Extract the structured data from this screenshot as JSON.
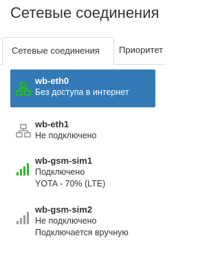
{
  "page": {
    "title": "Сетевые соединения"
  },
  "tabs": [
    {
      "label": "Сетевые соединения",
      "active": true
    },
    {
      "label": "Приоритет",
      "active": false
    }
  ],
  "connections": [
    {
      "name": "wb-eth0",
      "lines": [
        "Без доступа в интернет"
      ],
      "icon": "ethernet-icon",
      "icon_color": "#22bb22",
      "selected": true
    },
    {
      "name": "wb-eth1",
      "lines": [
        "Не подключено"
      ],
      "icon": "ethernet-icon",
      "icon_color": "#999999",
      "selected": false
    },
    {
      "name": "wb-gsm-sim1",
      "lines": [
        "Подключено",
        "YOTA - 70% (LTE)"
      ],
      "icon": "signal-bars-icon",
      "icon_color": "#22bb22",
      "signal_level": 1.0,
      "selected": false
    },
    {
      "name": "wb-gsm-sim2",
      "lines": [
        "Не подключено",
        "Подключается вручную"
      ],
      "icon": "signal-bars-icon",
      "icon_color": "#999999",
      "signal_level": 1.0,
      "selected": false
    }
  ],
  "colors": {
    "selected_bg": "#337ab7",
    "connected": "#22bb22",
    "disconnected": "#999999"
  }
}
